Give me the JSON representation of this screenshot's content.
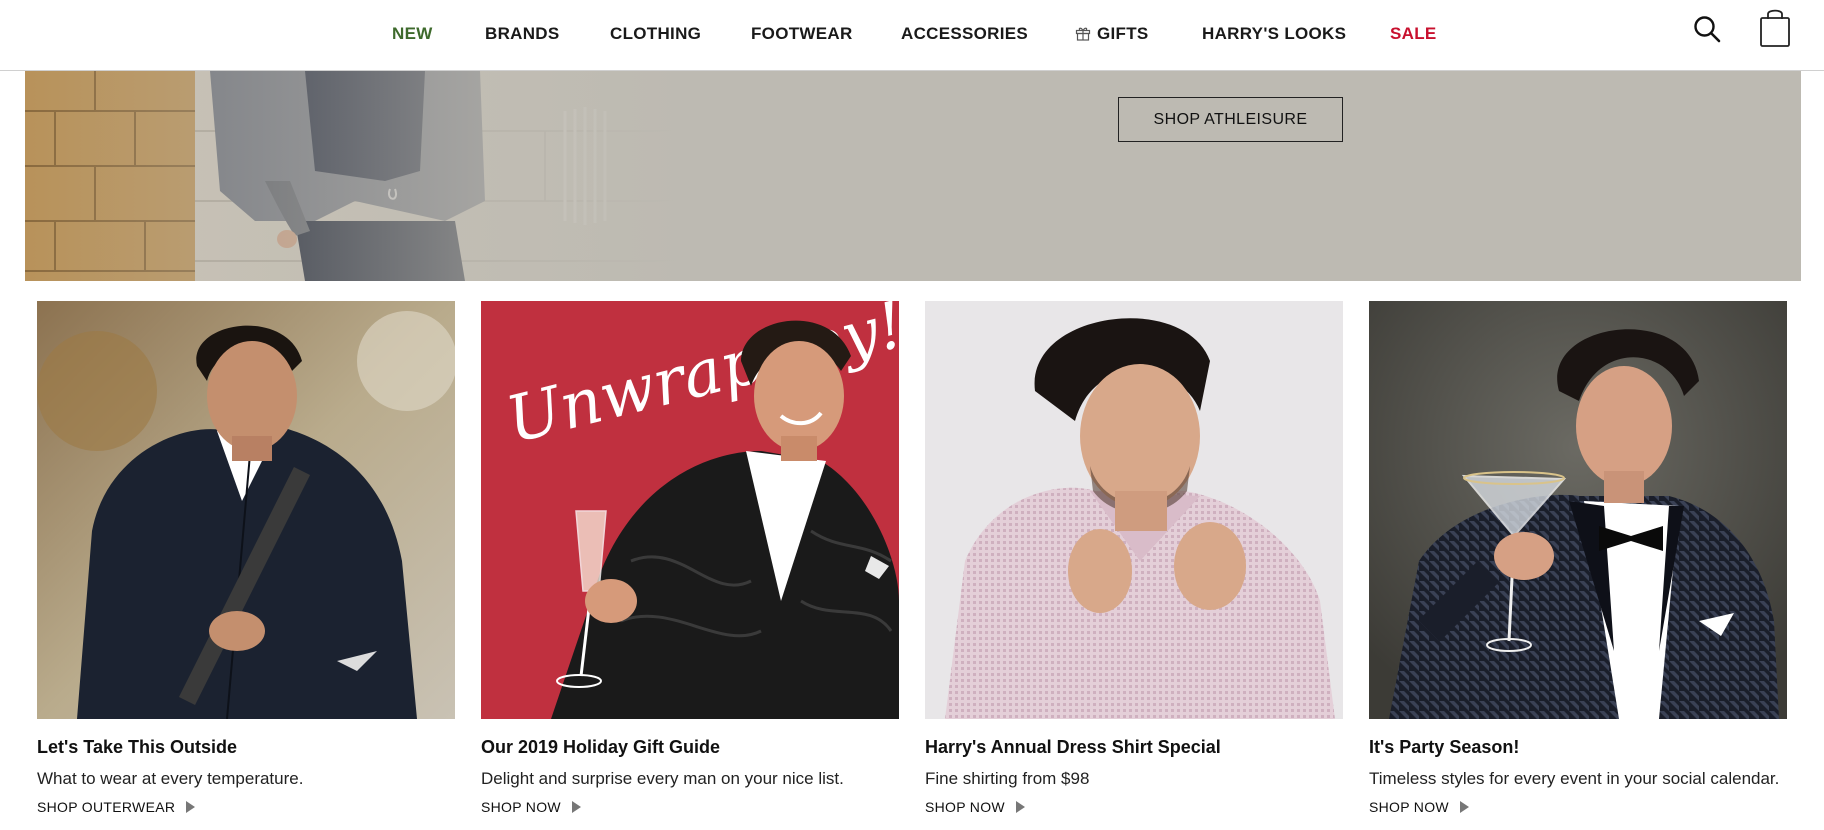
{
  "nav": {
    "items": [
      {
        "label": "NEW",
        "type": "new"
      },
      {
        "label": "BRANDS",
        "type": "normal"
      },
      {
        "label": "CLOTHING",
        "type": "normal"
      },
      {
        "label": "FOOTWEAR",
        "type": "normal"
      },
      {
        "label": "ACCESSORIES",
        "type": "normal"
      },
      {
        "label": "GIFTS",
        "type": "gift"
      },
      {
        "label": "HARRY'S LOOKS",
        "type": "normal"
      },
      {
        "label": "SALE",
        "type": "sale"
      }
    ],
    "icons": [
      "search-icon",
      "shopping-bag-icon",
      "gift-icon"
    ]
  },
  "hero": {
    "cta_label": "SHOP ATHLEISURE"
  },
  "cards": [
    {
      "title": "Let's Take This Outside",
      "subtitle": "What to wear at every temperature.",
      "link": "SHOP OUTERWEAR",
      "image_text": ""
    },
    {
      "title": "Our 2019 Holiday Gift Guide",
      "subtitle": "Delight and surprise every man on your nice list.",
      "link": "SHOP NOW",
      "image_text": "Unwrap Joy!"
    },
    {
      "title": "Harry's Annual Dress Shirt Special",
      "subtitle": "Fine shirting from $98",
      "link": "SHOP NOW",
      "image_text": ""
    },
    {
      "title": "It's Party Season!",
      "subtitle": "Timeless styles for every event in your social calendar.",
      "link": "SHOP NOW",
      "image_text": ""
    }
  ],
  "colors": {
    "new": "#3e6a2c",
    "sale": "#c8102e",
    "hero_bg": "#bdbab2",
    "holiday_red": "#c0303f"
  }
}
